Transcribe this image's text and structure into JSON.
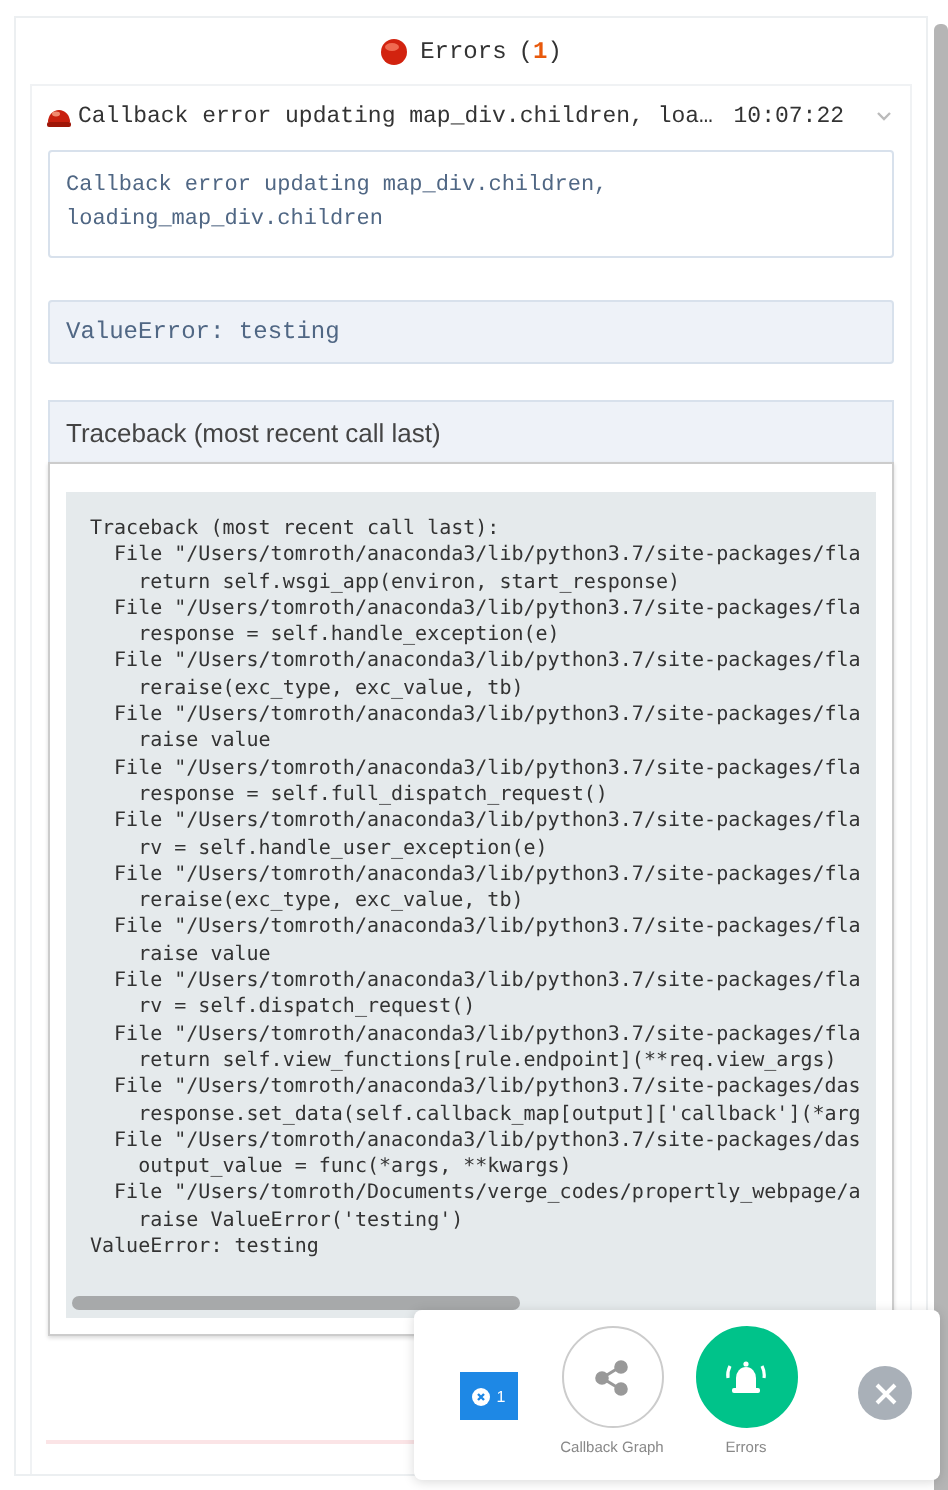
{
  "header": {
    "title": "Errors",
    "count_open": "(",
    "count": "1",
    "count_close": ")"
  },
  "errors": [
    {
      "summary": "Callback error updating map_div.children, loa…",
      "time": "10:07:22",
      "expanded": true,
      "message": "Callback error updating map_div.children, loading_map_div.children",
      "error": "ValueError: testing",
      "traceback_title": "Traceback (most recent call last)",
      "traceback": [
        "Traceback (most recent call last):",
        "  File \"/Users/tomroth/anaconda3/lib/python3.7/site-packages/fla",
        "    return self.wsgi_app(environ, start_response)",
        "  File \"/Users/tomroth/anaconda3/lib/python3.7/site-packages/fla",
        "    response = self.handle_exception(e)",
        "  File \"/Users/tomroth/anaconda3/lib/python3.7/site-packages/fla",
        "    reraise(exc_type, exc_value, tb)",
        "  File \"/Users/tomroth/anaconda3/lib/python3.7/site-packages/fla",
        "    raise value",
        "  File \"/Users/tomroth/anaconda3/lib/python3.7/site-packages/fla",
        "    response = self.full_dispatch_request()",
        "  File \"/Users/tomroth/anaconda3/lib/python3.7/site-packages/fla",
        "    rv = self.handle_user_exception(e)",
        "  File \"/Users/tomroth/anaconda3/lib/python3.7/site-packages/fla",
        "    reraise(exc_type, exc_value, tb)",
        "  File \"/Users/tomroth/anaconda3/lib/python3.7/site-packages/fla",
        "    raise value",
        "  File \"/Users/tomroth/anaconda3/lib/python3.7/site-packages/fla",
        "    rv = self.dispatch_request()",
        "  File \"/Users/tomroth/anaconda3/lib/python3.7/site-packages/fla",
        "    return self.view_functions[rule.endpoint](**req.view_args)",
        "  File \"/Users/tomroth/anaconda3/lib/python3.7/site-packages/das",
        "    response.set_data(self.callback_map[output]['callback'](*arg",
        "  File \"/Users/tomroth/anaconda3/lib/python3.7/site-packages/das",
        "    output_value = func(*args, **kwargs)",
        "  File \"/Users/tomroth/Documents/verge_codes/propertly_webpage/a",
        "    raise ValueError('testing')",
        "ValueError: testing"
      ]
    }
  ],
  "footer": {
    "error_badge": "1",
    "buttons": [
      {
        "kind": "graph",
        "label": "Callback Graph",
        "selected": false
      },
      {
        "kind": "errors",
        "label": "Errors",
        "selected": true
      }
    ]
  }
}
